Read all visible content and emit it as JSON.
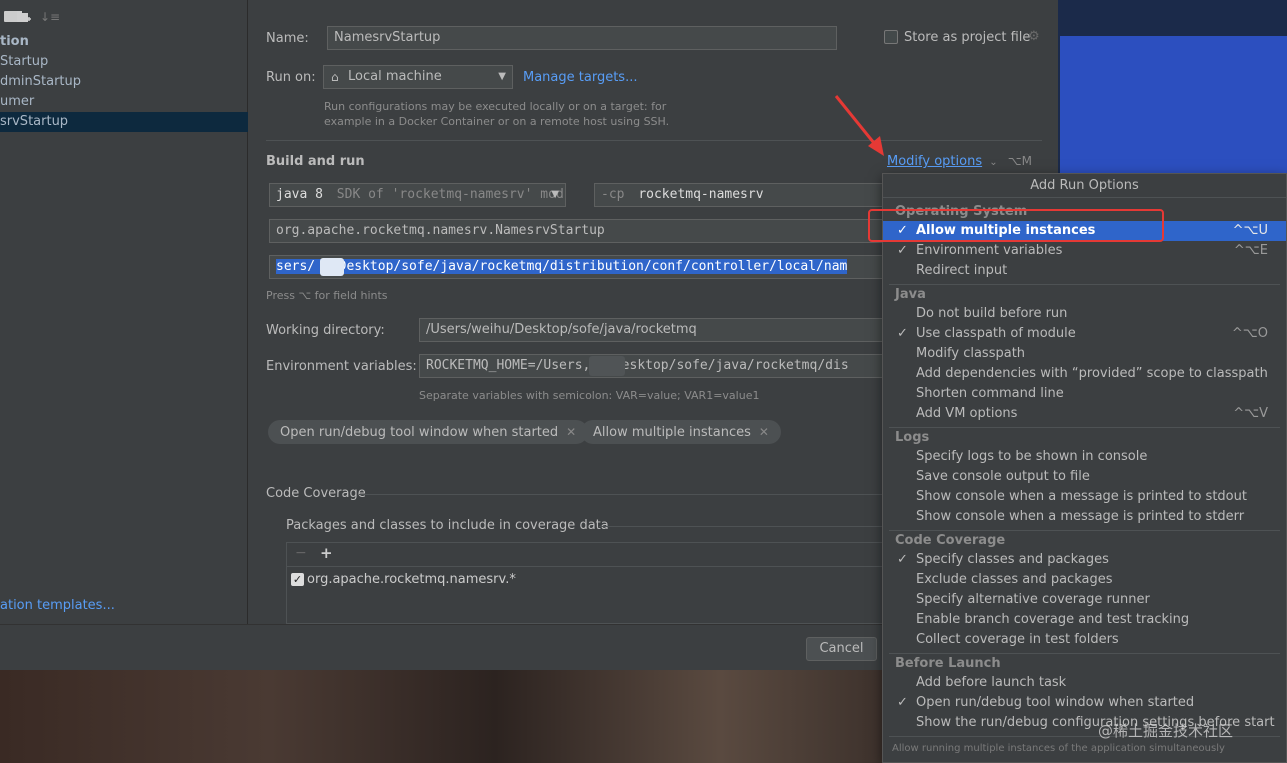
{
  "sidebar": {
    "items": [
      {
        "label": "tion"
      },
      {
        "label": "Startup"
      },
      {
        "label": "dminStartup"
      },
      {
        "label": "umer"
      },
      {
        "label": "srvStartup"
      }
    ],
    "templates_link": "ation templates..."
  },
  "form": {
    "name_label": "Name:",
    "name_value": "NamesrvStartup",
    "store_label": "Store as project file",
    "run_on_label": "Run on:",
    "run_on_value": "Local machine",
    "manage_targets": "Manage targets...",
    "run_on_hint_1": "Run configurations may be executed locally or on a target: for",
    "run_on_hint_2": "example in a Docker Container or on a remote host using SSH.",
    "build_run_title": "Build and run",
    "modify_options": "Modify options",
    "modify_shortcut": "⌥M",
    "jdk_value": "java 8",
    "jdk_hint": "SDK of 'rocketmq-namesrv' mod",
    "cp_prefix": "-cp",
    "cp_value": "rocketmq-namesrv",
    "main_class": "org.apache.rocketmq.namesrv.NamesrvStartup",
    "program_args": "sers/  /Desktop/sofe/java/rocketmq/distribution/conf/controller/local/nam",
    "field_hint": "Press ⌥ for field hints",
    "workdir_label": "Working directory:",
    "workdir_value": "/Users/weihu/Desktop/sofe/java/rocketmq",
    "env_label": "Environment variables:",
    "env_value": "ROCKETMQ_HOME=/Users,  /Desktop/sofe/java/rocketmq/dis",
    "env_hint": "Separate variables with semicolon: VAR=value; VAR1=value1",
    "chips": [
      "Open run/debug tool window when started",
      "Allow multiple instances"
    ],
    "coverage_title": "Code Coverage",
    "coverage_sub": "Packages and classes to include in coverage data",
    "coverage_pkg": "org.apache.rocketmq.namesrv.*",
    "cancel": "Cancel"
  },
  "popup": {
    "title": "Add Run Options",
    "groups": {
      "os": "Operating System",
      "java": "Java",
      "logs": "Logs",
      "coverage": "Code Coverage",
      "before": "Before Launch"
    },
    "os_items": [
      {
        "label": "Allow multiple instances",
        "checked": true,
        "shortcut": "^⌥U"
      },
      {
        "label": "Environment variables",
        "checked": true,
        "shortcut": "^⌥E"
      },
      {
        "label": "Redirect input",
        "checked": false,
        "shortcut": ""
      }
    ],
    "java_items": [
      {
        "label": "Do not build before run",
        "checked": false,
        "shortcut": ""
      },
      {
        "label": "Use classpath of module",
        "checked": true,
        "shortcut": "^⌥O"
      },
      {
        "label": "Modify classpath",
        "checked": false,
        "shortcut": ""
      },
      {
        "label": "Add dependencies with “provided” scope to classpath",
        "checked": false,
        "shortcut": ""
      },
      {
        "label": "Shorten command line",
        "checked": false,
        "shortcut": ""
      },
      {
        "label": "Add VM options",
        "checked": false,
        "shortcut": "^⌥V"
      }
    ],
    "logs_items": [
      {
        "label": "Specify logs to be shown in console",
        "checked": false,
        "shortcut": ""
      },
      {
        "label": "Save console output to file",
        "checked": false,
        "shortcut": ""
      },
      {
        "label": "Show console when a message is printed to stdout",
        "checked": false,
        "shortcut": ""
      },
      {
        "label": "Show console when a message is printed to stderr",
        "checked": false,
        "shortcut": ""
      }
    ],
    "coverage_items": [
      {
        "label": "Specify classes and packages",
        "checked": true,
        "shortcut": ""
      },
      {
        "label": "Exclude classes and packages",
        "checked": false,
        "shortcut": ""
      },
      {
        "label": "Specify alternative coverage runner",
        "checked": false,
        "shortcut": ""
      },
      {
        "label": "Enable branch coverage and test tracking",
        "checked": false,
        "shortcut": ""
      },
      {
        "label": "Collect coverage in test folders",
        "checked": false,
        "shortcut": ""
      }
    ],
    "before_items": [
      {
        "label": "Add before launch task",
        "checked": false,
        "shortcut": ""
      },
      {
        "label": "Open run/debug tool window when started",
        "checked": true,
        "shortcut": ""
      },
      {
        "label": "Show the run/debug configuration settings before start",
        "checked": false,
        "shortcut": ""
      }
    ],
    "footer_hint": "Allow running multiple instances of the application simultaneously"
  },
  "watermark": "@稀土掘金技术社区",
  "colors": {
    "accent": "#2f65ca",
    "link": "#589df6",
    "annotation": "#e53935"
  }
}
